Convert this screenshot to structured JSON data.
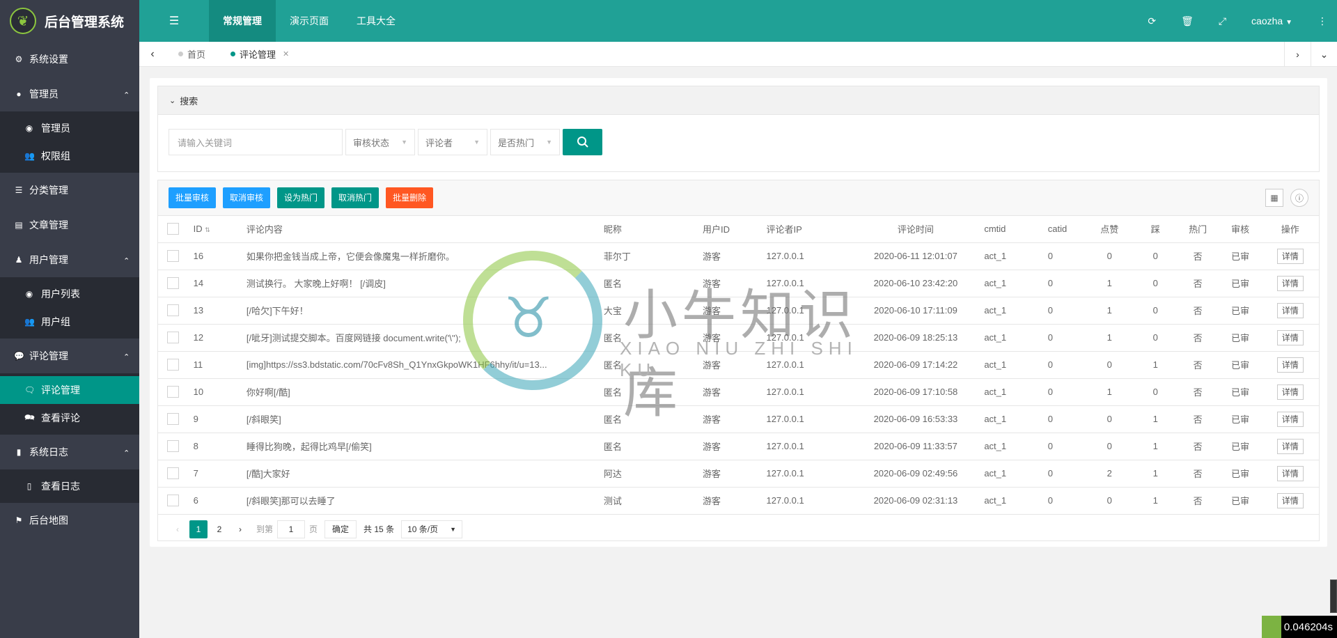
{
  "app": {
    "title": "后台管理系统"
  },
  "header": {
    "tabs": [
      "常规管理",
      "演示页面",
      "工具大全"
    ],
    "user": "caozha"
  },
  "sidebar": {
    "items": [
      {
        "label": "系统设置",
        "icon": "gears-icon"
      },
      {
        "label": "管理员",
        "icon": "user-circle-icon",
        "children": [
          {
            "label": "管理员",
            "icon": "user-circle-icon"
          },
          {
            "label": "权限组",
            "icon": "users-icon"
          }
        ]
      },
      {
        "label": "分类管理",
        "icon": "list-icon"
      },
      {
        "label": "文章管理",
        "icon": "newspaper-icon"
      },
      {
        "label": "用户管理",
        "icon": "user-icon",
        "children": [
          {
            "label": "用户列表",
            "icon": "user-circle-icon"
          },
          {
            "label": "用户组",
            "icon": "users-icon"
          }
        ]
      },
      {
        "label": "评论管理",
        "icon": "comment-icon",
        "children": [
          {
            "label": "评论管理",
            "icon": "comment-outline-icon",
            "active": true
          },
          {
            "label": "查看评论",
            "icon": "comments-icon"
          }
        ]
      },
      {
        "label": "系统日志",
        "icon": "file-icon",
        "children": [
          {
            "label": "查看日志",
            "icon": "file-text-icon"
          }
        ]
      },
      {
        "label": "后台地图",
        "icon": "map-sign-icon"
      }
    ]
  },
  "tabsbar": {
    "tabs": [
      "首页",
      "评论管理"
    ]
  },
  "search": {
    "title": "搜索",
    "keyword_placeholder": "请输入关键词",
    "filters": [
      "审核状态",
      "评论者",
      "是否热门"
    ]
  },
  "toolbar": {
    "buttons": [
      "批量审核",
      "取消审核",
      "设为热门",
      "取消热门",
      "批量删除"
    ]
  },
  "table": {
    "columns": [
      "ID",
      "评论内容",
      "昵称",
      "用户ID",
      "评论者IP",
      "评论时间",
      "cmtid",
      "catid",
      "点赞",
      "踩",
      "热门",
      "审核",
      "操作"
    ],
    "detail_label": "详情",
    "rows": [
      [
        "16",
        "如果你把金钱当成上帝，它便会像魔鬼一样折磨你。",
        "菲尔丁",
        "游客",
        "127.0.0.1",
        "2020-06-11 12:01:07",
        "act_1",
        "0",
        "0",
        "0",
        "否",
        "已审"
      ],
      [
        "14",
        "测试换行。 大家晚上好啊！ [/调皮]",
        "匿名",
        "游客",
        "127.0.0.1",
        "2020-06-10 23:42:20",
        "act_1",
        "0",
        "1",
        "0",
        "否",
        "已审"
      ],
      [
        "13",
        "[/哈欠]下午好！",
        "大宝",
        "游客",
        "127.0.0.1",
        "2020-06-10 17:11:09",
        "act_1",
        "0",
        "1",
        "0",
        "否",
        "已审"
      ],
      [
        "12",
        "[/呲牙]测试提交脚本。百度网链接 document.write('\\'');",
        "匿名",
        "游客",
        "127.0.0.1",
        "2020-06-09 18:25:13",
        "act_1",
        "0",
        "1",
        "0",
        "否",
        "已审"
      ],
      [
        "11",
        "[img]https://ss3.bdstatic.com/70cFv8Sh_Q1YnxGkpoWK1HF6hhy/it/u=13...",
        "匿名",
        "游客",
        "127.0.0.1",
        "2020-06-09 17:14:22",
        "act_1",
        "0",
        "0",
        "1",
        "否",
        "已审"
      ],
      [
        "10",
        "你好啊[/酷]",
        "匿名",
        "游客",
        "127.0.0.1",
        "2020-06-09 17:10:58",
        "act_1",
        "0",
        "1",
        "0",
        "否",
        "已审"
      ],
      [
        "9",
        "[/斜眼笑]",
        "匿名",
        "游客",
        "127.0.0.1",
        "2020-06-09 16:53:33",
        "act_1",
        "0",
        "0",
        "1",
        "否",
        "已审"
      ],
      [
        "8",
        "睡得比狗晚，起得比鸡早[/偷笑]",
        "匿名",
        "游客",
        "127.0.0.1",
        "2020-06-09 11:33:57",
        "act_1",
        "0",
        "0",
        "1",
        "否",
        "已审"
      ],
      [
        "7",
        "[/酷]大家好",
        "阿达",
        "游客",
        "127.0.0.1",
        "2020-06-09 02:49:56",
        "act_1",
        "0",
        "2",
        "1",
        "否",
        "已审"
      ],
      [
        "6",
        "[/斜眼笑]那可以去睡了",
        "测试",
        "游客",
        "127.0.0.1",
        "2020-06-09 02:31:13",
        "act_1",
        "0",
        "0",
        "1",
        "否",
        "已审"
      ]
    ]
  },
  "pager": {
    "pages": [
      "1",
      "2"
    ],
    "goto_label": "到第",
    "goto_value": "1",
    "page_unit": "页",
    "confirm": "确定",
    "total": "共 15 条",
    "page_size": "10 条/页"
  },
  "watermark": {
    "title": "小牛知识库",
    "subtitle": "XIAO NIU ZHI SHI KU"
  },
  "timer": "0.046204s",
  "colors": {
    "accent": "#009688",
    "header": "#20a196",
    "sidebar": "#393d49",
    "blue": "#1e9fff",
    "danger": "#ff5722"
  }
}
